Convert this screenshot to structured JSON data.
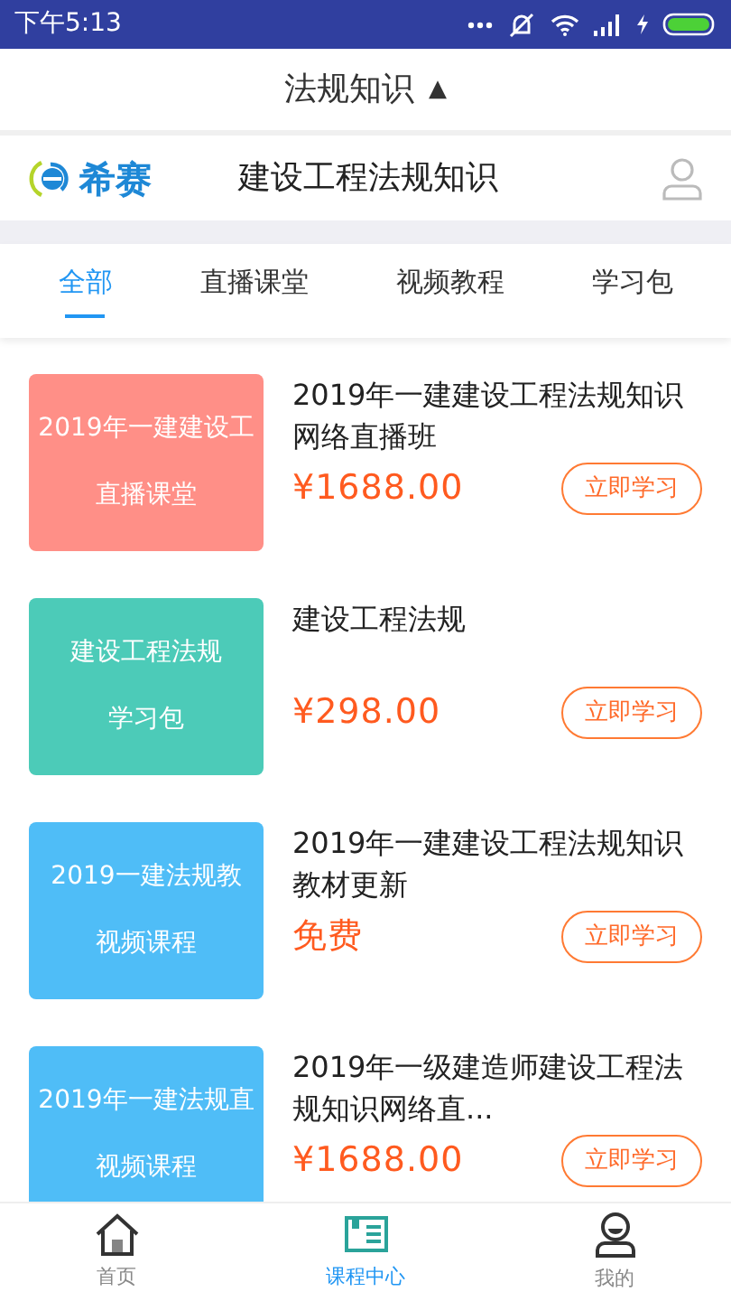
{
  "status_bar": {
    "time": "下午5:13"
  },
  "header": {
    "title": "法规知识",
    "toggle": "▲"
  },
  "brand": {
    "logo_text": "希赛",
    "title": "建设工程法规知识"
  },
  "tabs": [
    {
      "label": "全部",
      "selected": true
    },
    {
      "label": "直播课堂",
      "selected": false
    },
    {
      "label": "视频教程",
      "selected": false
    },
    {
      "label": "学习包",
      "selected": false
    }
  ],
  "courses": [
    {
      "thumb_title": "2019年一建建设工",
      "thumb_type": "直播课堂",
      "color": "#ff8f87",
      "title": "2019年一建建设工程法规知识网络直播班",
      "price": "¥1688.00",
      "button": "立即学习"
    },
    {
      "thumb_title": "建设工程法规",
      "thumb_type": "学习包",
      "color": "#4ccbb8",
      "title": "建设工程法规",
      "price": "¥298.00",
      "button": "立即学习"
    },
    {
      "thumb_title": "2019一建法规教",
      "thumb_type": "视频课程",
      "color": "#4fbdf7",
      "title": "2019年一建建设工程法规知识教材更新",
      "price": "免费",
      "button": "立即学习"
    },
    {
      "thumb_title": "2019年一建法规直",
      "thumb_type": "视频课程",
      "color": "#4fbdf7",
      "title": "2019年一级建造师建设工程法规知识网络直...",
      "price": "¥1688.00",
      "button": "立即学习"
    }
  ],
  "bottom_nav": [
    {
      "label": "首页",
      "selected": false
    },
    {
      "label": "课程中心",
      "selected": true
    },
    {
      "label": "我的",
      "selected": false
    }
  ]
}
